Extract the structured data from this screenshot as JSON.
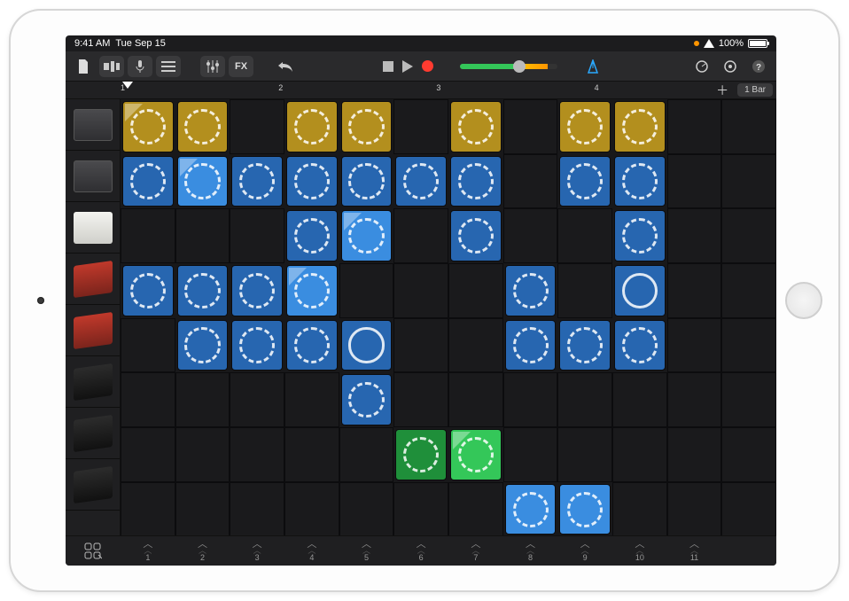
{
  "statusbar": {
    "time": "9:41 AM",
    "date": "Tue Sep 15",
    "battery_pct": "100%"
  },
  "toolbar": {
    "fx_label": "FX"
  },
  "ruler": {
    "marks": [
      "1",
      "2",
      "3",
      "4"
    ],
    "bar_label": "1 Bar"
  },
  "tracks": [
    {
      "id": "track-1",
      "instrument": "drummachine"
    },
    {
      "id": "track-2",
      "instrument": "drummachine"
    },
    {
      "id": "track-3",
      "instrument": "sampler"
    },
    {
      "id": "track-4",
      "instrument": "keys-red"
    },
    {
      "id": "track-5",
      "instrument": "keys-red"
    },
    {
      "id": "track-6",
      "instrument": "keys-dark"
    },
    {
      "id": "track-7",
      "instrument": "keys-dark"
    },
    {
      "id": "track-8",
      "instrument": "keys-dark"
    }
  ],
  "columns": [
    "1",
    "2",
    "3",
    "4",
    "5",
    "6",
    "7",
    "8",
    "9",
    "10",
    "11"
  ],
  "grid": [
    [
      {
        "c": "yellow",
        "p": true
      },
      {
        "c": "yellow"
      },
      null,
      {
        "c": "yellow"
      },
      {
        "c": "yellow"
      },
      null,
      {
        "c": "yellow"
      },
      null,
      {
        "c": "yellow"
      },
      {
        "c": "yellow"
      },
      null,
      null
    ],
    [
      {
        "c": "blue"
      },
      {
        "c": "blue-light",
        "p": true
      },
      {
        "c": "blue"
      },
      {
        "c": "blue"
      },
      {
        "c": "blue"
      },
      {
        "c": "blue"
      },
      {
        "c": "blue"
      },
      null,
      {
        "c": "blue"
      },
      {
        "c": "blue"
      },
      null,
      null
    ],
    [
      null,
      null,
      null,
      {
        "c": "blue"
      },
      {
        "c": "blue-light",
        "p": true
      },
      null,
      {
        "c": "blue"
      },
      null,
      null,
      {
        "c": "blue"
      },
      null,
      null
    ],
    [
      {
        "c": "blue"
      },
      {
        "c": "blue"
      },
      {
        "c": "blue"
      },
      {
        "c": "blue-light",
        "p": true
      },
      null,
      null,
      null,
      {
        "c": "blue"
      },
      null,
      {
        "c": "blue",
        "s": "solid"
      },
      null,
      null
    ],
    [
      null,
      {
        "c": "blue"
      },
      {
        "c": "blue"
      },
      {
        "c": "blue"
      },
      {
        "c": "blue",
        "s": "solid"
      },
      null,
      null,
      {
        "c": "blue"
      },
      {
        "c": "blue"
      },
      {
        "c": "blue"
      },
      null,
      null
    ],
    [
      null,
      null,
      null,
      null,
      {
        "c": "blue"
      },
      null,
      null,
      null,
      null,
      null,
      null,
      null
    ],
    [
      null,
      null,
      null,
      null,
      null,
      {
        "c": "green"
      },
      {
        "c": "green-light",
        "p": true
      },
      null,
      null,
      null,
      null,
      null
    ],
    [
      null,
      null,
      null,
      null,
      null,
      null,
      null,
      {
        "c": "blue-light"
      },
      {
        "c": "blue-light"
      },
      null,
      null,
      null
    ]
  ]
}
